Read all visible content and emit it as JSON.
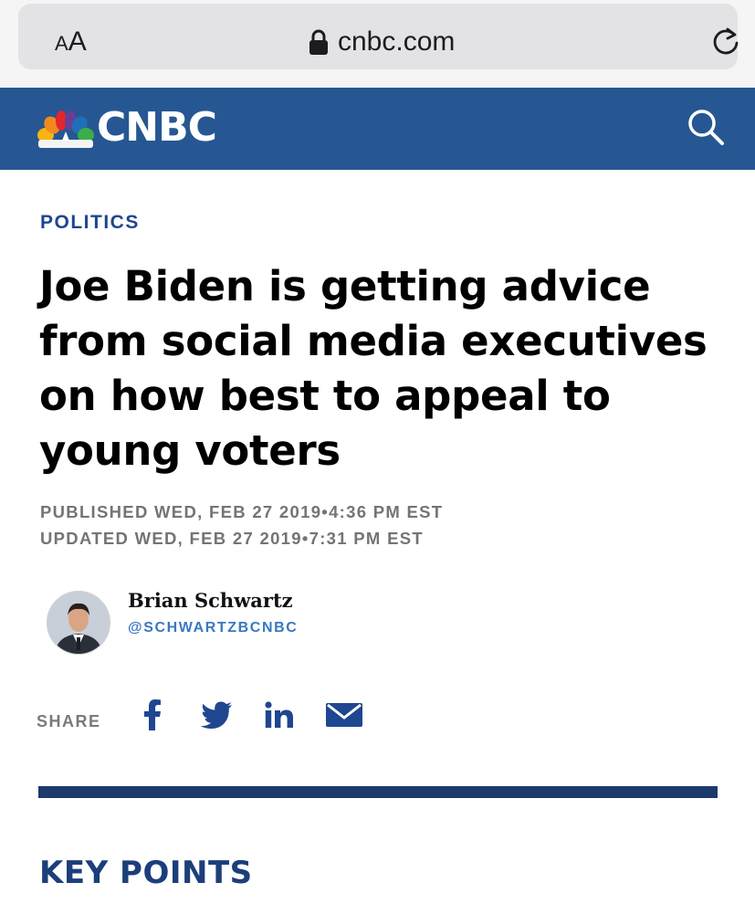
{
  "browser": {
    "text_size_label_small": "A",
    "text_size_label_large": "A",
    "url": "cnbc.com"
  },
  "site": {
    "wordmark": "CNBC",
    "brand_color": "#265792"
  },
  "article": {
    "section": "POLITICS",
    "headline": "Joe Biden is getting advice from social media executives on how best to appeal to young voters",
    "published": "PUBLISHED WED, FEB 27 2019•4:36 PM EST",
    "updated": "UPDATED WED, FEB 27 2019•7:31 PM EST",
    "author": {
      "name": "Brian Schwartz",
      "handle": "@SCHWARTZBCNBC"
    },
    "share": {
      "label": "SHARE",
      "icons": [
        "facebook-icon",
        "twitter-icon",
        "linkedin-icon",
        "email-icon"
      ]
    },
    "key_points_heading": "KEY POINTS"
  }
}
